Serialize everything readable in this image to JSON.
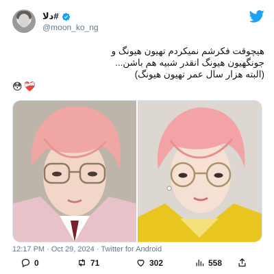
{
  "tweet": {
    "author": {
      "display_name": "دلا#",
      "handle": "@moon_ko_ng",
      "verified": true
    },
    "text_lines": [
      "هیچوقت فکرشم نمیکردم تهیون هیونگ و",
      "جونگهیون هیونگ انقدر شبیه هم باشن...",
      "(البته هزار سال عمر تهیون هیونگ)"
    ],
    "emoji": [
      "😳",
      "❤️‍🩹"
    ],
    "timestamp": "12:17 PM · Oct 29, 2024 · ",
    "source": "Twitter for Android",
    "stats": {
      "replies": "0",
      "retweets": "71",
      "likes": "302",
      "views": "558"
    },
    "media": [
      {
        "subject": "pink-haired person with round glasses, pink jacket"
      },
      {
        "subject": "pink-haired person with round glasses, yellow jacket"
      }
    ]
  },
  "colors": {
    "brand": "#1da1f2",
    "text": "#14171a",
    "muted": "#657786",
    "hair": "#f0a6a2"
  },
  "icons": [
    "verified-icon",
    "twitter-bird-icon",
    "reply-icon",
    "retweet-icon",
    "like-icon",
    "views-icon",
    "share-icon"
  ]
}
